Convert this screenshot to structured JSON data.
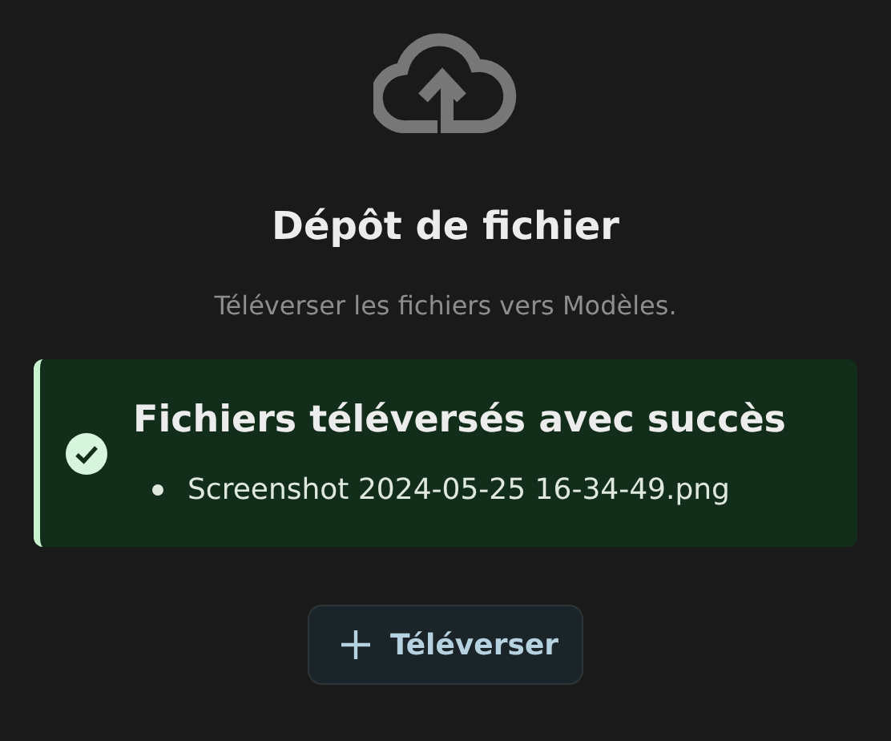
{
  "title": "Dépôt de fichier",
  "subtitle": "Téléverser les fichiers vers Modèles.",
  "alert": {
    "kind": "success",
    "title": "Fichiers téléversés avec succès",
    "files": [
      "Screenshot 2024-05-25 16-34-49.png"
    ]
  },
  "button": {
    "label": "Téléverser"
  }
}
